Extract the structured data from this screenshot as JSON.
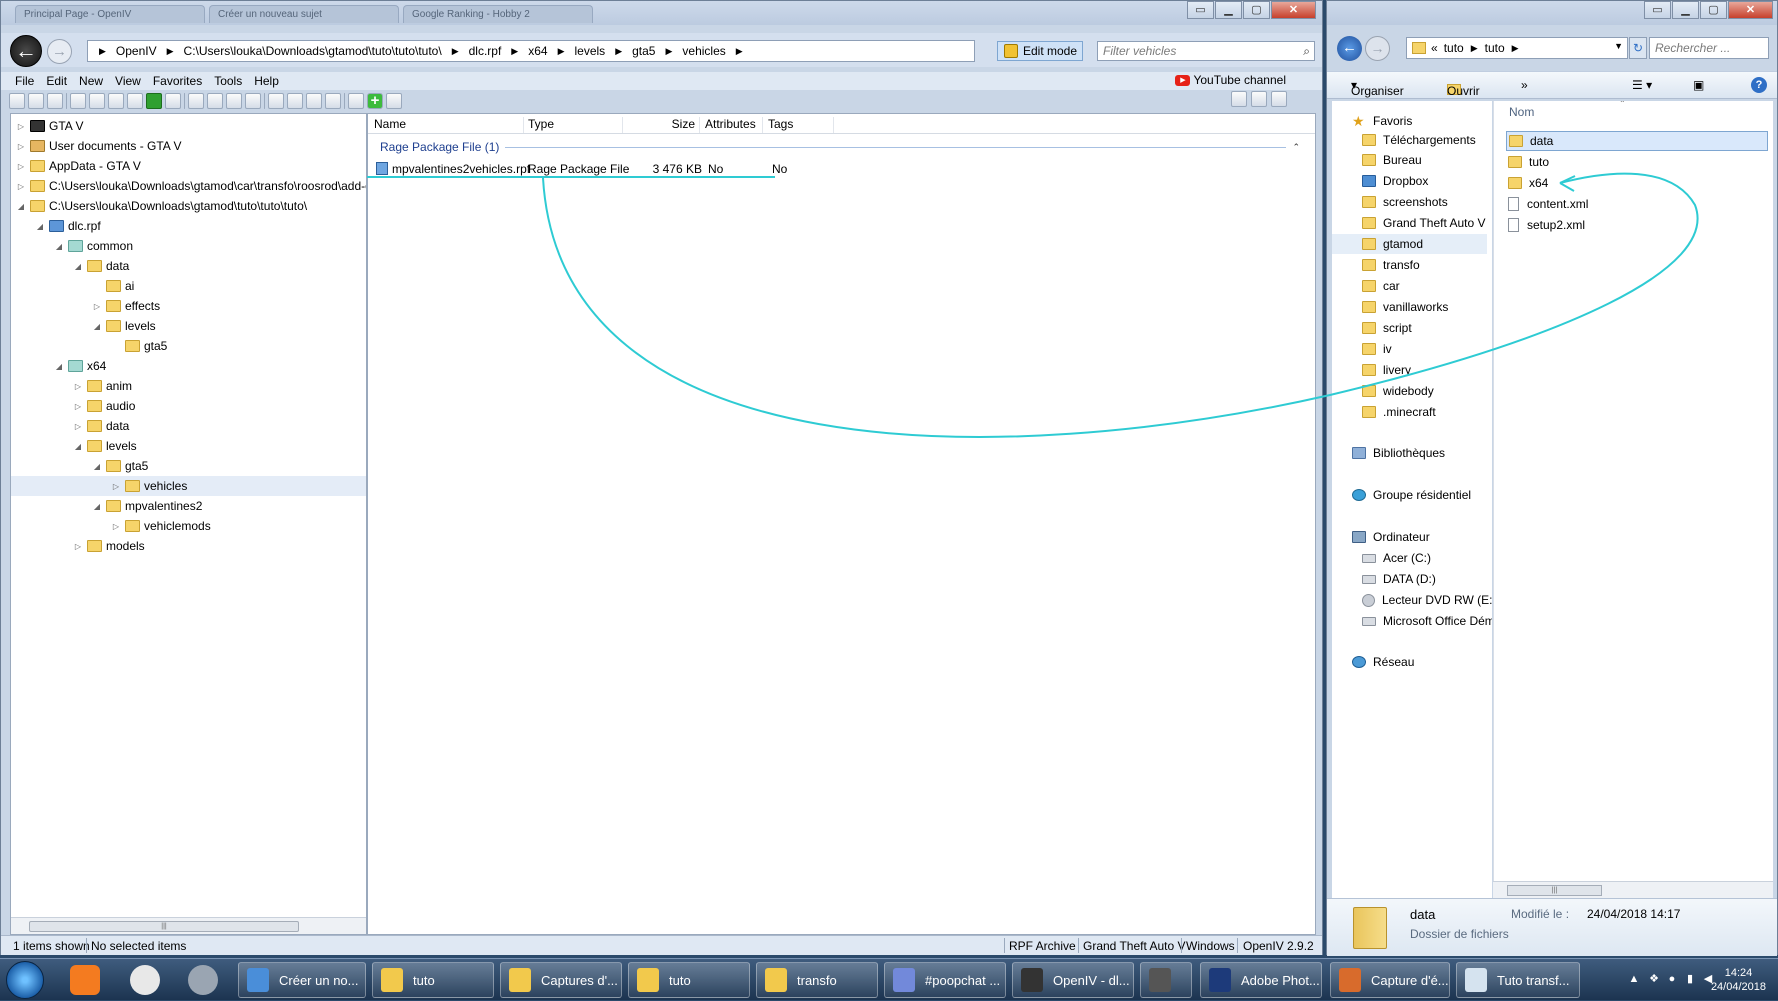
{
  "openiv": {
    "tabs": [
      "Principal Page - OpenIV",
      "Créer un nouveau sujet",
      "Google Ranking - Hobby 2"
    ],
    "breadcrumb": [
      "OpenIV",
      "C:\\Users\\louka\\Downloads\\gtamod\\tuto\\tuto\\tuto\\",
      "dlc.rpf",
      "x64",
      "levels",
      "gta5",
      "vehicles"
    ],
    "edit_mode": "Edit mode",
    "filter_placeholder": "Filter vehicles",
    "menu": [
      "File",
      "Edit",
      "New",
      "View",
      "Favorites",
      "Tools",
      "Help"
    ],
    "youtube": "YouTube channel",
    "tree": [
      {
        "label": "GTA V",
        "icon": "gta-icon",
        "exp": "▷"
      },
      {
        "label": "User documents - GTA V",
        "icon": "user-folder-icon",
        "exp": "▷"
      },
      {
        "label": "AppData - GTA V",
        "icon": "folder-icon",
        "exp": "▷"
      },
      {
        "label": "C:\\Users\\louka\\Downloads\\gtamod\\car\\transfo\\roosrod\\add-on se",
        "icon": "folder-icon",
        "exp": "▷"
      },
      {
        "label": "C:\\Users\\louka\\Downloads\\gtamod\\tuto\\tuto\\tuto\\",
        "icon": "folder-icon",
        "exp": "◢"
      },
      {
        "label": "dlc.rpf",
        "icon": "rpf-icon",
        "exp": "◢"
      },
      {
        "label": "common",
        "icon": "teal-folder-icon",
        "exp": "◢"
      },
      {
        "label": "data",
        "icon": "folder-icon",
        "exp": "◢"
      },
      {
        "label": "ai",
        "icon": "folder-icon",
        "exp": ""
      },
      {
        "label": "effects",
        "icon": "folder-icon",
        "exp": "▷"
      },
      {
        "label": "levels",
        "icon": "folder-icon",
        "exp": "◢"
      },
      {
        "label": "gta5",
        "icon": "folder-icon",
        "exp": ""
      },
      {
        "label": "x64",
        "icon": "teal-folder-icon",
        "exp": "◢"
      },
      {
        "label": "anim",
        "icon": "folder-icon",
        "exp": "▷"
      },
      {
        "label": "audio",
        "icon": "folder-icon",
        "exp": "▷"
      },
      {
        "label": "data",
        "icon": "folder-icon",
        "exp": "▷"
      },
      {
        "label": "levels",
        "icon": "folder-icon",
        "exp": "◢"
      },
      {
        "label": "gta5",
        "icon": "folder-icon",
        "exp": "◢"
      },
      {
        "label": "vehicles",
        "icon": "folder-icon",
        "exp": "▷"
      },
      {
        "label": "mpvalentines2",
        "icon": "folder-icon",
        "exp": "◢"
      },
      {
        "label": "vehiclemods",
        "icon": "folder-icon",
        "exp": "▷"
      },
      {
        "label": "models",
        "icon": "folder-icon",
        "exp": "▷"
      }
    ],
    "columns": [
      "Name",
      "Type",
      "Size",
      "Attributes",
      "Tags"
    ],
    "group_label": "Rage Package File (1)",
    "file": {
      "name": "mpvalentines2vehicles.rpf",
      "type": "Rage Package File",
      "size": "3 476 KB",
      "attributes": "No",
      "tags": "No"
    },
    "status": {
      "items_shown": "1 items shown",
      "selected": "No selected items",
      "archive": "RPF Archive",
      "game": "Grand Theft Auto V",
      "platform": "Windows",
      "version": "OpenIV 2.9.2"
    }
  },
  "explorer": {
    "address": [
      "«",
      "tuto",
      "tuto"
    ],
    "search_placeholder": "Rechercher ...",
    "organize": "Organiser",
    "open": "Ouvrir",
    "more": "»",
    "column_name": "Nom",
    "nav": [
      {
        "label": "Favoris",
        "icon": "star-icon"
      },
      {
        "label": "Téléchargements",
        "icon": "folder-icon"
      },
      {
        "label": "Bureau",
        "icon": "folder-icon"
      },
      {
        "label": "Dropbox",
        "icon": "dropbox-icon"
      },
      {
        "label": "screenshots",
        "icon": "folder-icon"
      },
      {
        "label": "Grand Theft Auto V",
        "icon": "folder-icon"
      },
      {
        "label": "gtamod",
        "icon": "folder-icon"
      },
      {
        "label": "transfo",
        "icon": "folder-icon"
      },
      {
        "label": "car",
        "icon": "folder-icon"
      },
      {
        "label": "vanillaworks",
        "icon": "folder-icon"
      },
      {
        "label": "script",
        "icon": "folder-icon"
      },
      {
        "label": "iv",
        "icon": "folder-icon"
      },
      {
        "label": "livery",
        "icon": "folder-icon"
      },
      {
        "label": "widebody",
        "icon": "folder-icon"
      },
      {
        "label": ".minecraft",
        "icon": "folder-icon"
      },
      {
        "label": "Bibliothèques",
        "icon": "library-icon"
      },
      {
        "label": "Groupe résidentiel",
        "icon": "homegroup-icon"
      },
      {
        "label": "Ordinateur",
        "icon": "computer-icon"
      },
      {
        "label": "Acer (C:)",
        "icon": "drive-icon"
      },
      {
        "label": "DATA (D:)",
        "icon": "drive-icon"
      },
      {
        "label": "Lecteur DVD RW (E:)",
        "icon": "dvd-icon"
      },
      {
        "label": "Microsoft Office Dém",
        "icon": "drive-icon"
      },
      {
        "label": "Réseau",
        "icon": "network-icon"
      }
    ],
    "files": [
      {
        "label": "data",
        "kind": "folder"
      },
      {
        "label": "tuto",
        "kind": "folder"
      },
      {
        "label": "x64",
        "kind": "folder"
      },
      {
        "label": "content.xml",
        "kind": "file"
      },
      {
        "label": "setup2.xml",
        "kind": "file"
      }
    ],
    "details": {
      "name": "data",
      "type": "Dossier de fichiers",
      "modified_label": "Modifié le :",
      "modified": "24/04/2018 14:17"
    }
  },
  "taskbar": {
    "buttons": [
      "Créer un no...",
      "tuto",
      "Captures d'...",
      "tuto",
      "transfo",
      "#poopchat ...",
      "OpenIV - dl...",
      "",
      "Adobe Phot...",
      "Capture d'é...",
      "Tuto transf..."
    ],
    "time": "14:24",
    "date": "24/04/2018"
  },
  "colors": {
    "annotation": "#2ecbd3",
    "selection": "#d9e8fb"
  }
}
